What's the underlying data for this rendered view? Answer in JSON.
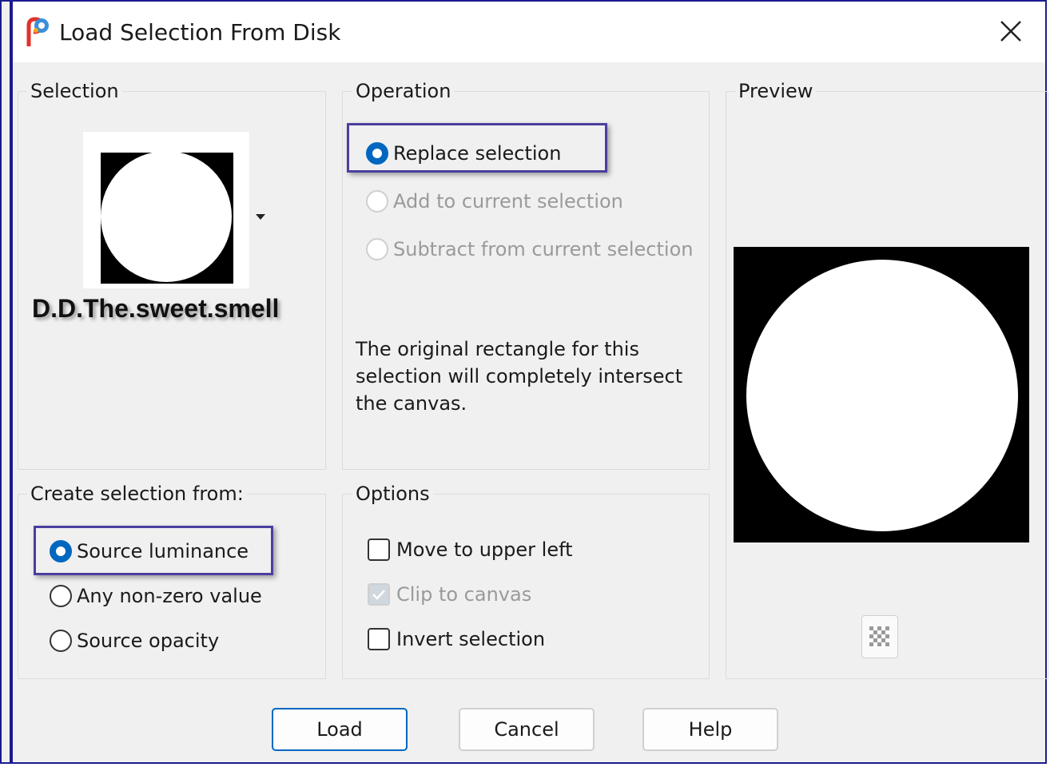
{
  "window": {
    "title": "Load Selection From Disk",
    "accent_color": "#0067c0",
    "frame_color": "#1b1c8f",
    "highlight_color": "#4a3f9f"
  },
  "selection": {
    "group_label": "Selection",
    "file_name": "D.D.The.sweet.smell",
    "dropdown_icon": "caret-down-icon"
  },
  "operation": {
    "group_label": "Operation",
    "options": [
      {
        "label": "Replace selection",
        "checked": true,
        "enabled": true
      },
      {
        "label": "Add to current selection",
        "checked": false,
        "enabled": false
      },
      {
        "label": "Subtract from current selection",
        "checked": false,
        "enabled": false
      }
    ],
    "message": "The original rectangle for this selection will completely intersect the canvas."
  },
  "create_from": {
    "group_label": "Create selection from:",
    "options": [
      {
        "label": "Source luminance",
        "checked": true
      },
      {
        "label": "Any non-zero value",
        "checked": false
      },
      {
        "label": "Source opacity",
        "checked": false
      }
    ]
  },
  "options": {
    "group_label": "Options",
    "items": [
      {
        "label": "Move to upper left",
        "checked": false,
        "enabled": true
      },
      {
        "label": "Clip to canvas",
        "checked": true,
        "enabled": false
      },
      {
        "label": "Invert selection",
        "checked": false,
        "enabled": true
      }
    ]
  },
  "preview": {
    "group_label": "Preview",
    "transparency_icon": "checkerboard-icon"
  },
  "buttons": {
    "load": "Load",
    "cancel": "Cancel",
    "help": "Help"
  }
}
